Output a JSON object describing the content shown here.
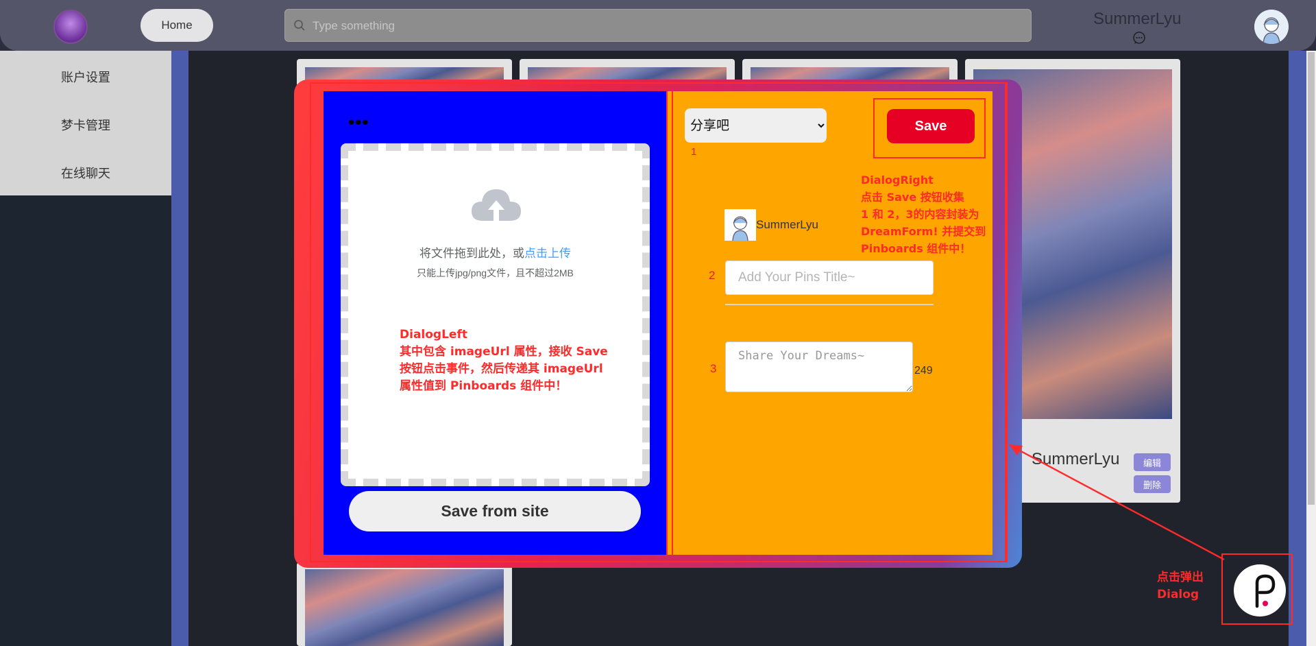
{
  "header": {
    "home_label": "Home",
    "search_placeholder": "Type something",
    "username": "SummerLyu"
  },
  "sidebar": {
    "items": [
      {
        "label": "账户设置"
      },
      {
        "label": "梦卡管理"
      },
      {
        "label": "在线聊天"
      }
    ]
  },
  "cards": {
    "author": "SummerLyu",
    "edit_label": "编辑",
    "delete_label": "删除"
  },
  "dialog": {
    "left": {
      "more_label": "•••",
      "upload_text": "将文件拖到此处，或",
      "upload_link": "点击上传",
      "upload_tip": "只能上传jpg/png文件，且不超过2MB",
      "save_from_site_label": "Save from site",
      "note_lines": [
        "DialogLeft",
        "其中包含 imageUrl 属性，接收 Save",
        "按钮点击事件，然后传递其 imageUrl",
        "属性值到 Pinboards 组件中！"
      ]
    },
    "right": {
      "board_selected": "分享吧",
      "save_label": "Save",
      "marker_1": "1",
      "marker_2": "2",
      "marker_3": "3",
      "username": "SummerLyu",
      "title_placeholder": "Add Your Pins Title~",
      "desc_placeholder": "Share Your Dreams~",
      "char_count": "249",
      "note_lines": [
        "DialogRight",
        "点击 Save 按钮收集",
        "1 和 2，3的内容封装为",
        "DreamForm! 并提交到",
        "Pinboards 组件中！"
      ]
    }
  },
  "annotation": {
    "popup_note_lines": [
      "点击弹出",
      "Dialog"
    ]
  },
  "colors": {
    "left_panel": "#0000ff",
    "right_panel": "#ffa500",
    "save_button": "#e60023",
    "annotation_red": "#ff2a2a"
  }
}
